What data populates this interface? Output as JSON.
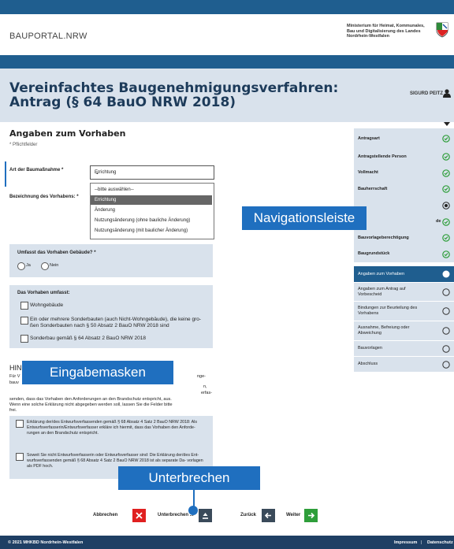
{
  "header": {
    "logo": "BAUPORTAL.NRW",
    "ministry": "Ministerium für Heimat, Kommunales, Bau und Digitalisierung des Landes Nordrhein-Westfalen"
  },
  "page": {
    "title": "Vereinfachtes Baugenehmigungsverfahren: Antrag (§ 64 BauO NRW 2018)",
    "user": "SIGURD PEITZ"
  },
  "form": {
    "section_title": "Angaben zum Vorhaben",
    "required_note": "* Pflichtfelder",
    "art_label": "Art der Baumaßnahme *",
    "art_value": "Errichtung",
    "bezeichnung_label": "Bezeichnung des Vorhabens: *",
    "dropdown_options": [
      "--bitte auswählen--",
      "Errichtung",
      "Änderung",
      "Nutzungsänderung (ohne bauliche Änderung)",
      "Nutzungsänderung (mit baulicher Änderung)"
    ],
    "gebaeude_label": "Umfasst das Vorhaben Gebäude? *",
    "radio_ja": "Ja",
    "radio_nein": "Nein",
    "umfasst_title": "Das Vorhaben umfasst:",
    "umfasst_items": [
      "Wohngebäude",
      "Ein oder mehrere Sonderbauten (auch Nicht-Wohngebäude), die keine gro- ßen Sonderbauten nach § 50 Absatz 2 BauO NRW 2018 sind",
      "Sonderbau gemäß § 64 Absatz 2 BauO NRW 2018"
    ],
    "hinweis_title": "HIN",
    "hinweis_text_left": "Für V",
    "hinweis_text_left2": "bauv",
    "hinweis_line3": "reichungen ... nach Entwurfsverfasser ... sen,",
    "hinweis_line4": "senden, dass das Vorhaben den Anforderungen an den Brandschutz entspricht, aus.",
    "hinweis_line5": "Wenn eine solche Erklärung nicht abgegeben werden soll, lassen Sie die Felder bitte",
    "hinweis_line6": "frei.",
    "hinweis_right1": "nge-",
    "hinweis_right2": "n,",
    "hinweis_right3": "erfas-",
    "hinweis_right4": "bitte",
    "erklaerung1": "Erklärung der/des Entwurfsverfassenden gemäß § 68 Absatz 4 Satz 2 BauO NRW 2018: Als Entwurfsverfasserin/Entwurfsverfasser erkläre ich hiermit, dass das Vorhaben den Anforde- rungen an den Brandschutz entspricht.",
    "erklaerung2": "Soweit Sie nicht Entwurfsverfasserin oder Entwurfsverfasser sind: Die Erklärung der/des Ent- wurfsverfassenden gemäß § 68 Absatz 4 Satz 2 BauO NRW 2018 ist als separate Da- vorlagen als PDF hoch."
  },
  "nav": {
    "items": [
      {
        "label": "Antragsart",
        "state": "done"
      },
      {
        "label": "Antragstellende Person",
        "state": "done"
      },
      {
        "label": "Vollmacht",
        "state": "done"
      },
      {
        "label": "Bauherrschaft",
        "state": "done"
      },
      {
        "label": "",
        "state": "current-step"
      },
      {
        "label": "de",
        "state": "done"
      },
      {
        "label": "Bauvorlageberechtigung",
        "state": "done"
      },
      {
        "label": "Baugrundstück",
        "state": "done"
      },
      {
        "label": "Angaben zum Vorhaben",
        "state": "active"
      },
      {
        "label": "Angaben zum Antrag auf Vorbescheid",
        "state": "open"
      },
      {
        "label": "Bindungen zur Beurteilung des Vorhabens",
        "state": "open"
      },
      {
        "label": "Ausnahme, Befreiung oder Abweichung",
        "state": "open"
      },
      {
        "label": "Bauvorlagen",
        "state": "open"
      },
      {
        "label": "Abschluss",
        "state": "open"
      }
    ]
  },
  "callouts": {
    "nav": "Navigationsleiste",
    "masks": "Eingabemasken",
    "pause": "Unterbrechen"
  },
  "actions": {
    "cancel": "Abbrechen",
    "pause": "Unterbrechen ...",
    "back": "Zurück",
    "next": "Weiter"
  },
  "footer": {
    "copyright": "© 2021 MHKBD Nordrhein-Westfalen",
    "impressum": "Impressum",
    "separator": "|",
    "datenschutz": "Datenschutz"
  },
  "colors": {
    "brand_blue": "#1f5e8f",
    "panel": "#d9e2ec",
    "done_green": "#2e9e3a",
    "cancel_red": "#e02020",
    "next_green": "#2e9e3a",
    "back_dark": "#3a4a5a"
  }
}
